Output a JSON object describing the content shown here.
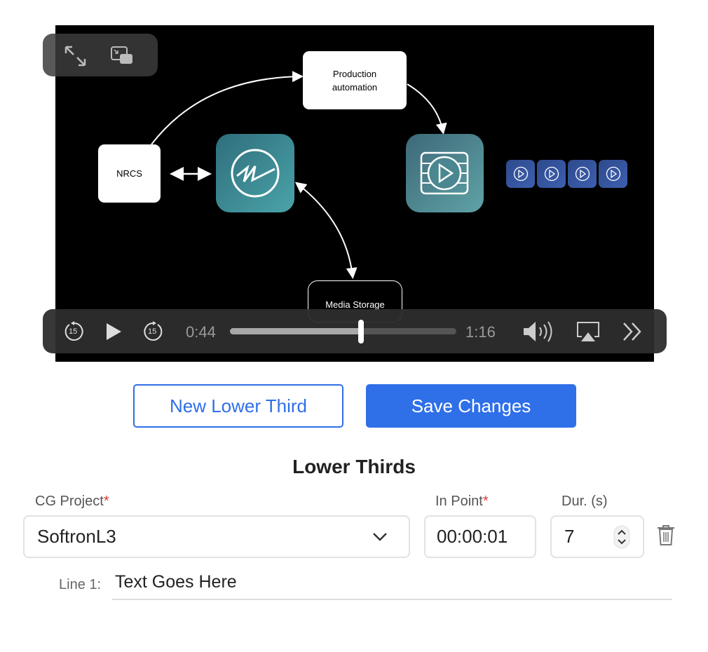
{
  "video": {
    "diagram": {
      "production": "Production\nautomation",
      "nrcs": "NRCS",
      "media_storage": "Media Storage"
    },
    "controls": {
      "current_time": "0:44",
      "duration": "1:16",
      "progress": 0.579,
      "skip_back": "15",
      "skip_forward": "15"
    }
  },
  "buttons": {
    "new_lower_third": "New Lower Third",
    "save_changes": "Save Changes"
  },
  "section": {
    "title": "Lower Thirds"
  },
  "form": {
    "cg_project_label": "CG Project",
    "in_point_label": "In Point",
    "duration_label": "Dur. (s)",
    "required_mark": "*",
    "cg_project_value": "SoftronL3",
    "in_point_value": "00:00:01",
    "duration_value": "7",
    "line1_label": "Line 1:",
    "line1_value": "Text Goes Here"
  },
  "colors": {
    "accent": "#2f6fe8",
    "required": "#e53935"
  }
}
